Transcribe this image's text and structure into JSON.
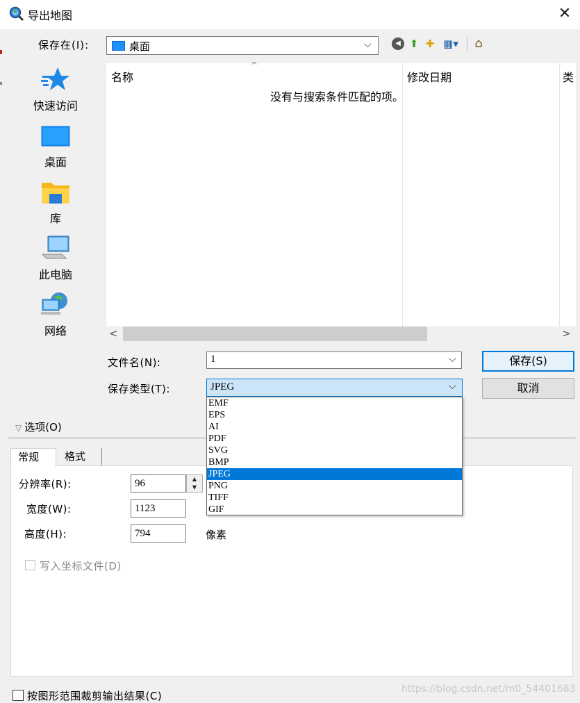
{
  "window": {
    "title": "导出地图",
    "close_glyph": "✕",
    "icon": "magnifier-globe-icon"
  },
  "toolbar": {
    "save_in_label": "保存在(I):",
    "save_in_value": "桌面",
    "dropdown_glyph": "⌵",
    "back_glyph": "◀",
    "up_glyph": "⬆",
    "new_folder_glyph": "✚",
    "view_glyph": "▦▾",
    "home_glyph": "⌂"
  },
  "places": [
    {
      "label": "快速访问",
      "icon": "star-icon"
    },
    {
      "label": "桌面",
      "icon": "desktop-icon"
    },
    {
      "label": "库",
      "icon": "library-folder-icon"
    },
    {
      "label": "此电脑",
      "icon": "computer-icon"
    },
    {
      "label": "网络",
      "icon": "network-icon"
    }
  ],
  "file_list": {
    "columns": [
      "名称",
      "修改日期",
      "类"
    ],
    "sort_glyph": "^",
    "empty_message": "没有与搜索条件匹配的项。",
    "scroll_left": "<",
    "scroll_right": ">"
  },
  "file_name": {
    "label": "文件名(N):",
    "value": "1"
  },
  "file_type": {
    "label": "保存类型(T):",
    "value": "JPEG",
    "options": [
      "EMF",
      "EPS",
      "AI",
      "PDF",
      "SVG",
      "BMP",
      "JPEG",
      "PNG",
      "TIFF",
      "GIF"
    ],
    "selected_index": 6
  },
  "buttons": {
    "save": "保存(S)",
    "cancel": "取消"
  },
  "options": {
    "toggle_label": "选项(O)",
    "toggle_glyph": "▽",
    "tabs": [
      "常规",
      "格式"
    ],
    "resolution_label": "分辨率(R):",
    "resolution_value": "96",
    "width_label": "宽度(W):",
    "width_value": "1123",
    "height_label": "高度(H):",
    "height_value": "794",
    "units": "像素",
    "spin_up": "▲",
    "spin_down": "▼",
    "world_file_label": "写入坐标文件(D)"
  },
  "clip_label": "按图形范围裁剪输出结果(C)",
  "watermark": "https://blog.csdn.net/m0_54401683",
  "colors": {
    "selection": "#0078d7",
    "select_focus_bg": "#cce4f7",
    "panel_bg": "#f0f0f0"
  }
}
